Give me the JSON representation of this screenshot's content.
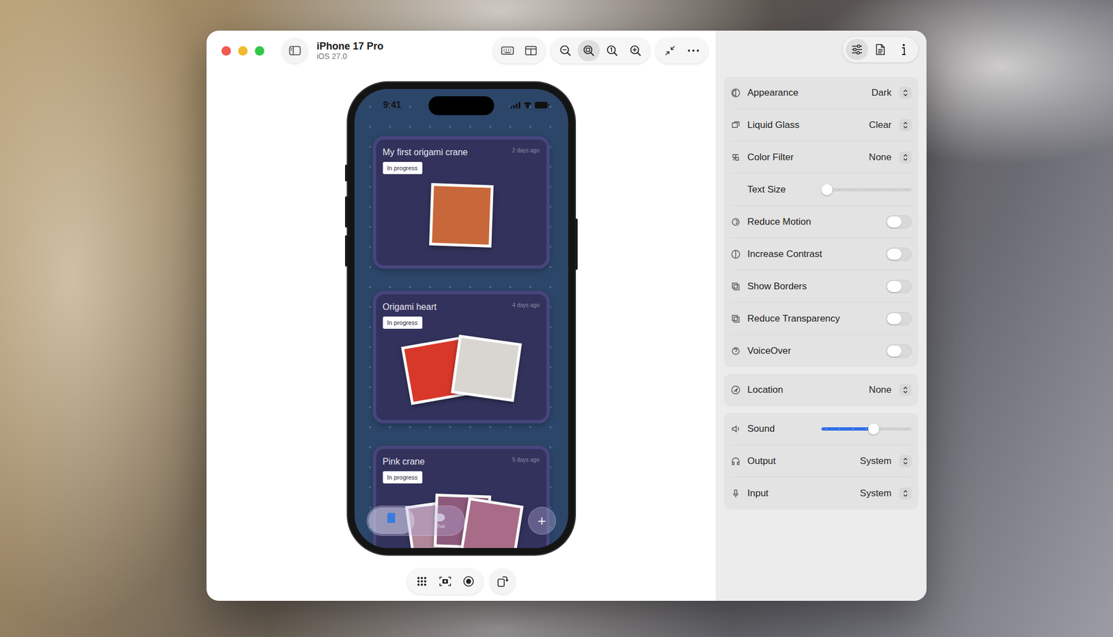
{
  "device": {
    "name": "iPhone 17 Pro",
    "os": "iOS 27.0"
  },
  "toolbar": {
    "zoom_buttons": [
      {
        "selected": false
      },
      {
        "selected": true
      },
      {
        "selected": false
      },
      {
        "selected": false
      }
    ]
  },
  "inspector_tabs": [
    {
      "selected": true
    },
    {
      "selected": false
    },
    {
      "selected": false
    }
  ],
  "phone": {
    "time": "9:41",
    "cards": [
      {
        "title": "My first origami crane",
        "date": "2 days ago",
        "badge": "In progress",
        "photos": [
          {
            "color": "#c8683a"
          }
        ]
      },
      {
        "title": "Origami heart",
        "date": "4 days ago",
        "badge": "In progress",
        "photos": [
          {
            "color": "#d8382a"
          },
          {
            "color": "#d9d6d2"
          }
        ]
      },
      {
        "title": "Pink crane",
        "date": "5 days ago",
        "badge": "In progress",
        "photos": [
          {
            "color": "#b0889a"
          },
          {
            "color": "#8e5a7c"
          },
          {
            "color": "#a86c88"
          }
        ]
      }
    ],
    "tab_bar": {
      "tabs": [
        {
          "label": "",
          "selected": true
        },
        {
          "label": "Chat",
          "selected": false
        }
      ],
      "add_button": "+"
    }
  },
  "settings_groups": [
    [
      {
        "kind": "select",
        "label": "Appearance",
        "value": "Dark"
      },
      {
        "kind": "select",
        "label": "Liquid Glass",
        "value": "Clear"
      },
      {
        "kind": "select",
        "label": "Color Filter",
        "value": "None"
      },
      {
        "kind": "slider",
        "label": "Text Size",
        "level": 0.0
      },
      {
        "kind": "toggle",
        "label": "Reduce Motion",
        "on": false
      },
      {
        "kind": "toggle",
        "label": "Increase Contrast",
        "on": false
      },
      {
        "kind": "toggle",
        "label": "Show Borders",
        "on": false
      },
      {
        "kind": "toggle",
        "label": "Reduce Transparency",
        "on": false
      },
      {
        "kind": "toggle",
        "label": "VoiceOver",
        "on": false
      }
    ],
    [
      {
        "kind": "select",
        "label": "Location",
        "value": "None"
      }
    ],
    [
      {
        "kind": "slider",
        "label": "Sound",
        "level": 0.59
      },
      {
        "kind": "select",
        "label": "Output",
        "value": "System"
      },
      {
        "kind": "select",
        "label": "Input",
        "value": "System"
      }
    ]
  ]
}
